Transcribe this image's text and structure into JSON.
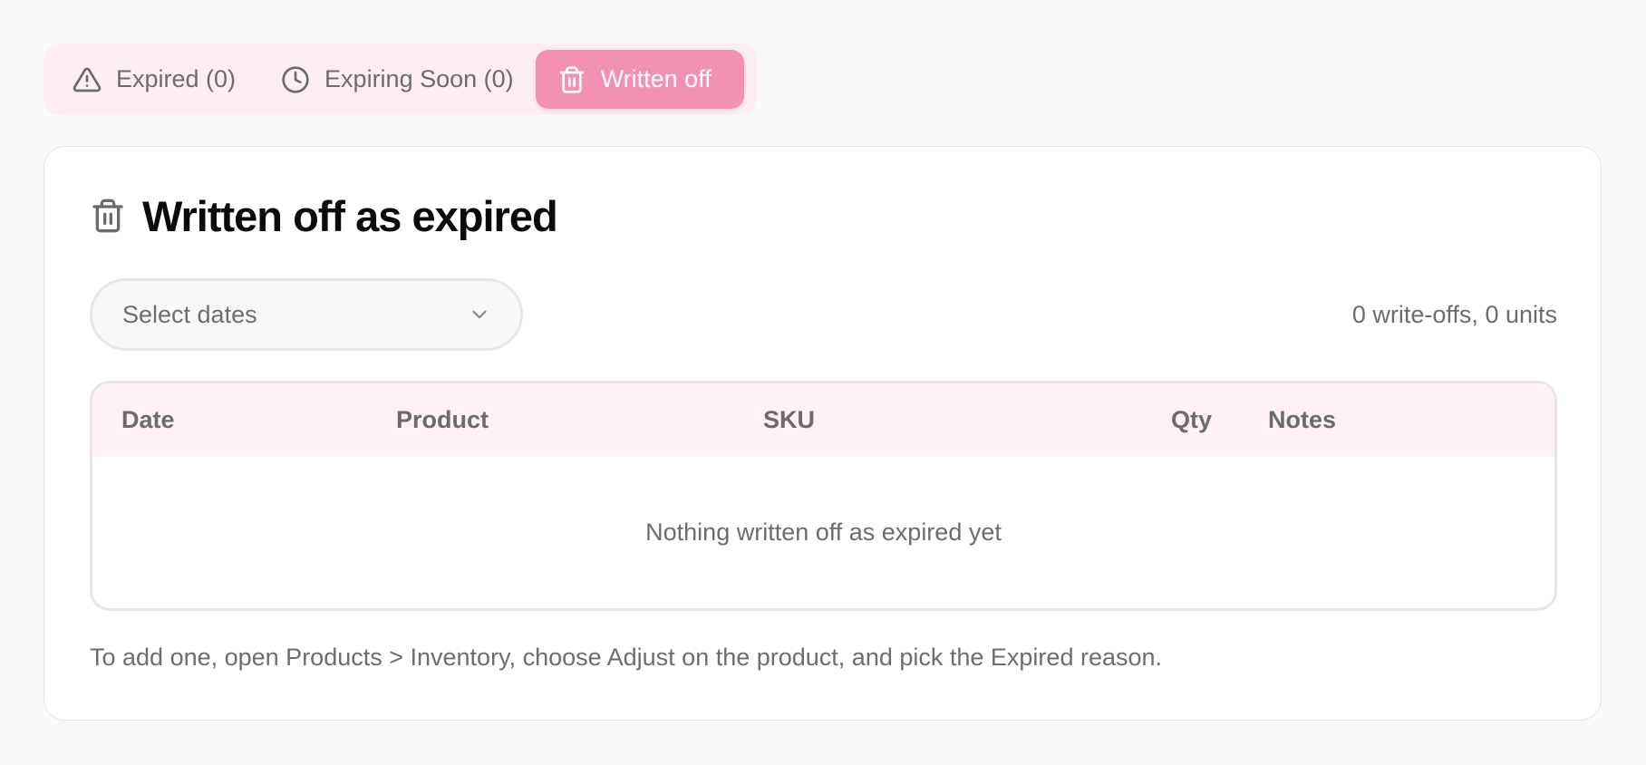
{
  "tabs": [
    {
      "label": "Expired (0)",
      "icon": "warning-triangle-icon"
    },
    {
      "label": "Expiring Soon (0)",
      "icon": "clock-icon"
    },
    {
      "label": "Written off",
      "icon": "trash-icon",
      "active": true
    }
  ],
  "card": {
    "title": "Written off as expired",
    "title_icon": "trash-icon",
    "date_select": {
      "placeholder": "Select dates"
    },
    "summary": "0 write-offs, 0 units",
    "table": {
      "columns": [
        "Date",
        "Product",
        "SKU",
        "Qty",
        "Notes"
      ],
      "rows": [],
      "empty_message": "Nothing written off as expired yet"
    },
    "hint": "To add one, open Products > Inventory, choose Adjust on the product, and pick the Expired reason."
  },
  "colors": {
    "page_background": "#f9f9f9",
    "tab_bar_background": "#fdeef2",
    "active_tab": "#f291b1",
    "table_header_background": "#fff1f5"
  }
}
